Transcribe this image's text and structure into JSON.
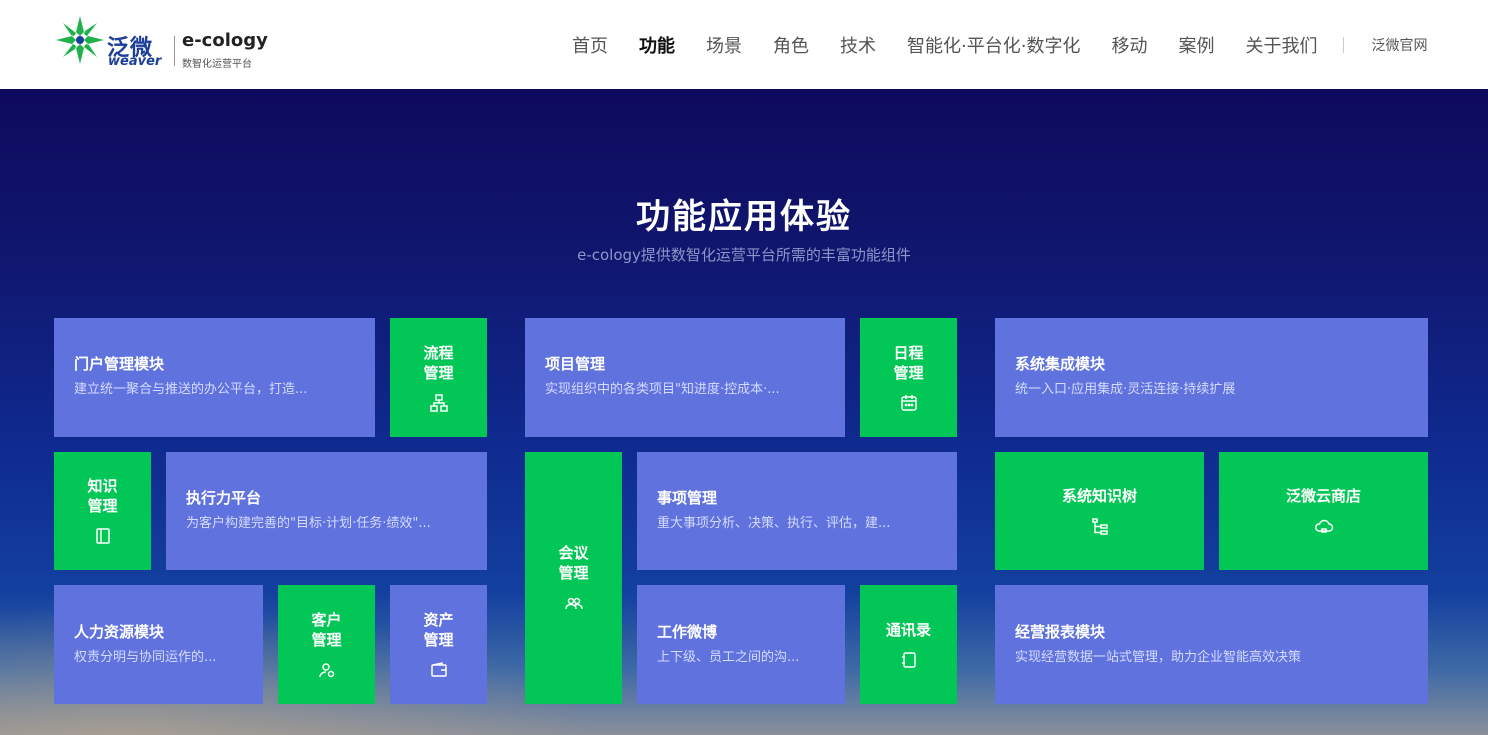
{
  "brand": {
    "cn": "泛微",
    "en": "weaver",
    "product": "e-cology",
    "tagline": "数智化运营平台",
    "logo_icon": "weaver-star-icon"
  },
  "nav": {
    "items": [
      "首页",
      "功能",
      "场景",
      "角色",
      "技术",
      "智能化·平台化·数字化",
      "移动",
      "案例",
      "关于我们"
    ],
    "active": "功能",
    "external": "泛微官网"
  },
  "hero": {
    "title": "功能应用体验",
    "subtitle": "e-cology提供数智化运营平台所需的丰富功能组件"
  },
  "tiles": {
    "portal": {
      "title": "门户管理模块",
      "desc": "建立统一聚合与推送的办公平台，打造..."
    },
    "workflow": {
      "line1": "流程",
      "line2": "管理",
      "icon": "org-chart-icon"
    },
    "project": {
      "title": "项目管理",
      "desc": "实现组织中的各类项目\"知进度·控成本·..."
    },
    "schedule": {
      "line1": "日程",
      "line2": "管理",
      "icon": "calendar-icon"
    },
    "integration": {
      "title": "系统集成模块",
      "desc": "统一入口·应用集成·灵活连接·持续扩展"
    },
    "knowledge": {
      "line1": "知识",
      "line2": "管理",
      "icon": "book-icon"
    },
    "execution": {
      "title": "执行力平台",
      "desc": "为客户构建完善的\"目标·计划·任务·绩效\"..."
    },
    "meeting": {
      "line1": "会议",
      "line2": "管理",
      "icon": "people-icon"
    },
    "affairs": {
      "title": "事项管理",
      "desc": "重大事项分析、决策、执行、评估，建..."
    },
    "knowledge_tree": {
      "label": "系统知识树",
      "icon": "tree-icon"
    },
    "cloud_store": {
      "label": "泛微云商店",
      "icon": "cloud-store-icon"
    },
    "hr": {
      "title": "人力资源模块",
      "desc": "权责分明与协同运作的..."
    },
    "customer": {
      "line1": "客户",
      "line2": "管理",
      "icon": "customer-icon"
    },
    "asset": {
      "line1": "资产",
      "line2": "管理",
      "icon": "wallet-icon"
    },
    "weibo": {
      "title": "工作微博",
      "desc": "上下级、员工之间的沟..."
    },
    "contacts": {
      "label": "通讯录",
      "icon": "address-book-icon"
    },
    "report": {
      "title": "经营报表模块",
      "desc": "实现经营数据一站式管理，助力企业智能高效决策"
    }
  },
  "colors": {
    "tile_blue": "#5f72de",
    "tile_green": "#02c655",
    "brand_blue": "#1a3c9a",
    "brand_green": "#1fb24a"
  }
}
